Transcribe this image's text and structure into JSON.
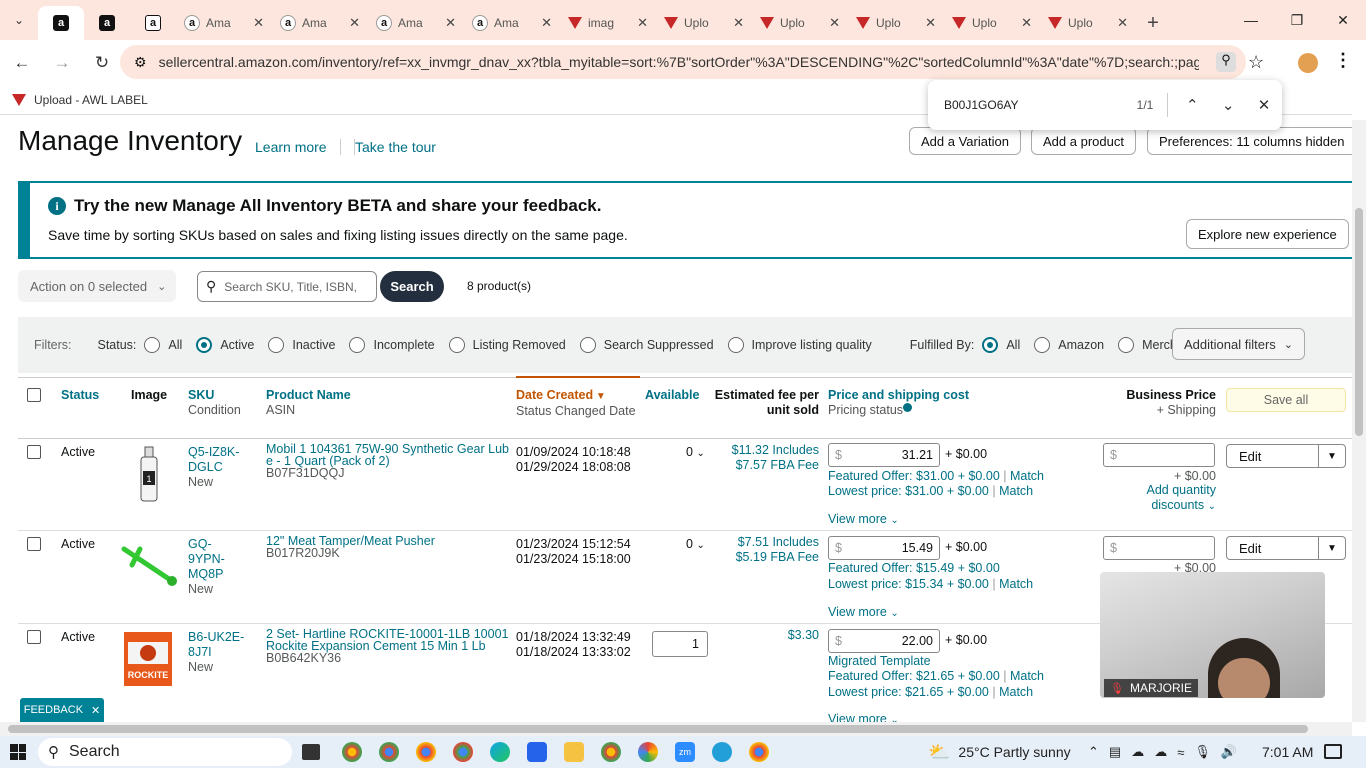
{
  "browser": {
    "tabs": [
      {
        "label": "",
        "icon": "amazon-icon",
        "pinned": true,
        "active": true
      },
      {
        "label": "",
        "icon": "amazon-icon",
        "pinned": true
      },
      {
        "label": "",
        "icon": "amazon-outline-icon",
        "pinned": true
      },
      {
        "label": "Ama",
        "icon": "amazon-round-icon"
      },
      {
        "label": "Ama",
        "icon": "amazon-round-icon"
      },
      {
        "label": "Ama",
        "icon": "amazon-round-icon"
      },
      {
        "label": "Ama",
        "icon": "amazon-round-icon"
      },
      {
        "label": "imag",
        "icon": "awl-icon"
      },
      {
        "label": "Uplo",
        "icon": "awl-icon"
      },
      {
        "label": "Uplo",
        "icon": "awl-icon"
      },
      {
        "label": "Uplo",
        "icon": "awl-icon"
      },
      {
        "label": "Uplo",
        "icon": "awl-icon"
      },
      {
        "label": "Uplo",
        "icon": "awl-icon"
      }
    ],
    "url": "sellercentral.amazon.com/inventory/ref=xx_invmgr_dnav_xx?tbla_myitable=sort:%7B\"sortOrder\"%3A\"DESCENDING\"%2C\"sortedColumnId\"%3A\"date\"%7D;search:;paginat...",
    "bookmark": "Upload - AWL LABEL"
  },
  "findbar": {
    "query": "B00J1GO6AY",
    "count": "1/1"
  },
  "page": {
    "title": "Manage Inventory",
    "learn_more": "Learn more",
    "take_tour": "Take the tour",
    "add_variation": "Add a Variation",
    "add_product": "Add a product",
    "preferences": "Preferences: 11 columns hidden",
    "banner_title": "Try the new Manage All Inventory BETA and share your feedback.",
    "banner_sub": "Save time by sorting SKUs based on sales and fixing listing issues directly on the same page.",
    "explore": "Explore new experience",
    "action_select": "Action on 0 selected",
    "search_placeholder": "Search SKU, Title, ISBN,",
    "search_btn": "Search",
    "product_count": "8 product(s)",
    "feedback": "FEEDBACK"
  },
  "filters": {
    "label": "Filters:",
    "status_label": "Status:",
    "status_options": [
      "All",
      "Active",
      "Inactive",
      "Incomplete",
      "Listing Removed",
      "Search Suppressed",
      "Improve listing quality"
    ],
    "status_selected": "Active",
    "fulfilled_label": "Fulfilled By:",
    "fulfilled_options": [
      "All",
      "Amazon",
      "Merchant"
    ],
    "fulfilled_selected": "All",
    "additional": "Additional filters"
  },
  "table": {
    "headers": {
      "status": "Status",
      "image": "Image",
      "sku": "SKU",
      "condition": "Condition",
      "product_name": "Product Name",
      "asin": "ASIN",
      "date_created": "Date Created",
      "status_changed": "Status Changed Date",
      "available": "Available",
      "fee": "Estimated fee per unit sold",
      "price": "Price and shipping cost",
      "pricing_status": "Pricing status",
      "business_price": "Business Price",
      "shipping": "+ Shipping",
      "save_all": "Save all"
    },
    "rows": [
      {
        "status": "Active",
        "sku": "Q5-IZ8K-DGLC",
        "condition": "New",
        "name": "Mobil 1 104361 75W-90 Synthetic Gear Lube - 1 Quart (Pack of 2)",
        "asin": "B07F31DQQJ",
        "date_created": "01/09/2024 10:18:48",
        "status_changed": "01/29/2024 18:08:08",
        "available": "0",
        "fee": "$11.32 Includes $7.57 FBA Fee",
        "price": "31.21",
        "shipping": "+ $0.00",
        "featured": "Featured Offer: $31.00 + $0.00",
        "lowest": "Lowest price: $31.00 + $0.00",
        "match": "Match",
        "view_more": "View more",
        "bp_ship": "+ $0.00",
        "add_qty": "Add quantity discounts",
        "edit": "Edit"
      },
      {
        "status": "Active",
        "sku": "GQ-9YPN-MQ8P",
        "condition": "New",
        "name": "12\" Meat Tamper/Meat Pusher",
        "asin": "B017R20J9K",
        "date_created": "01/23/2024 15:12:54",
        "status_changed": "01/23/2024 15:18:00",
        "available": "0",
        "fee": "$7.51 Includes $5.19 FBA Fee",
        "price": "15.49",
        "shipping": "+ $0.00",
        "featured": "Featured Offer: $15.49 + $0.00",
        "lowest": "Lowest price: $15.34 + $0.00",
        "match": "Match",
        "view_more": "View more",
        "bp_ship": "+ $0.00",
        "edit": "Edit"
      },
      {
        "status": "Active",
        "sku": "B6-UK2E-8J7I",
        "condition": "New",
        "name": "2 Set- Hartline ROCKITE-10001-1LB 10001 Rockite Expansion Cement 15 Min 1 Lb",
        "asin": "B0B642KY36",
        "date_created": "01/18/2024 13:32:49",
        "status_changed": "01/18/2024 13:33:02",
        "available": "1",
        "fee": "$3.30",
        "price": "22.00",
        "shipping": "+ $0.00",
        "template": "Migrated Template",
        "featured": "Featured Offer: $21.65 + $0.00",
        "lowest": "Lowest price: $21.65 + $0.00",
        "match": "Match",
        "view_more": "View more"
      }
    ]
  },
  "video": {
    "name": "MARJORIE"
  },
  "taskbar": {
    "search": "Search",
    "weather": "25°C  Partly sunny",
    "time": "7:01 AM"
  },
  "colors": {
    "teal": "#008296",
    "link": "#007185",
    "orange": "#c45500",
    "tab_bg": "#fde6dd"
  }
}
